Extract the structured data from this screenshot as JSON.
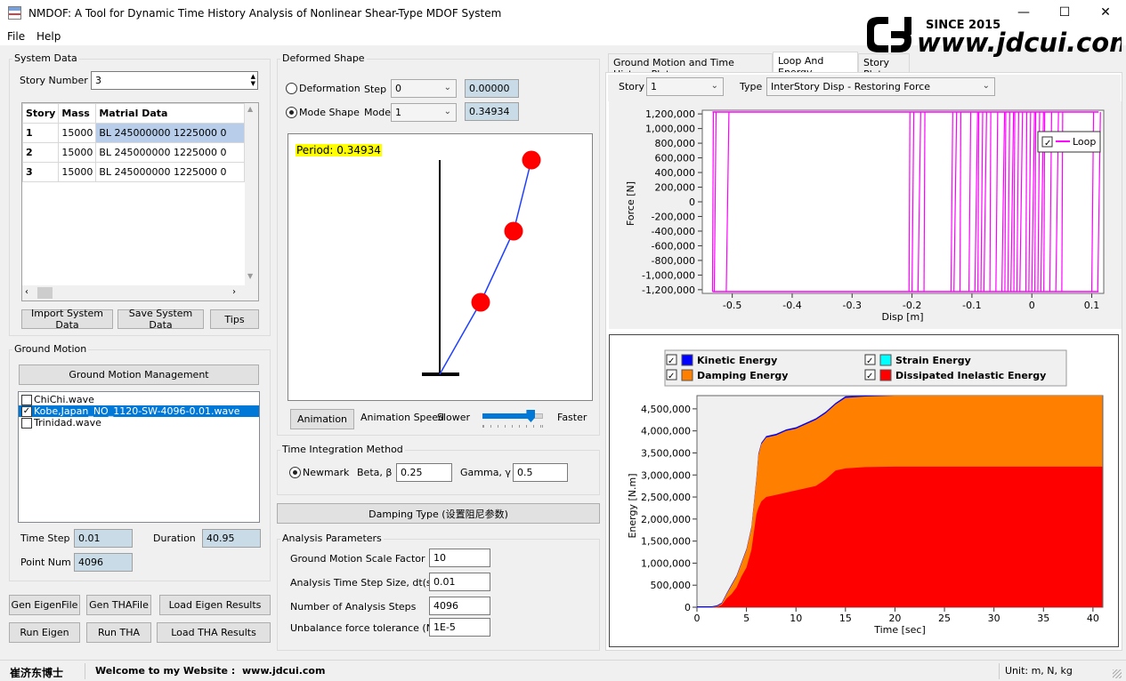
{
  "window": {
    "title": "NMDOF: A Tool for Dynamic Time History Analysis of Nonlinear Shear-Type MDOF System",
    "minimize": "—",
    "maximize": "☐",
    "close": "✕"
  },
  "menu": {
    "file": "File",
    "help": "Help"
  },
  "logo": {
    "since": "SINCE 2015",
    "text": "www.jdcui.com"
  },
  "system_data": {
    "group_label": "System Data",
    "story_number_label": "Story Number",
    "story_number_value": "3",
    "columns": [
      "Story",
      "Mass",
      "Matrial Data"
    ],
    "rows": [
      {
        "story": "1",
        "mass": "15000",
        "material": "BL 245000000 1225000 0"
      },
      {
        "story": "2",
        "mass": "15000",
        "material": "BL 245000000 1225000 0"
      },
      {
        "story": "3",
        "mass": "15000",
        "material": "BL 245000000 1225000 0"
      }
    ],
    "import_button": "Import System Data",
    "save_button": "Save System Data",
    "tips_button": "Tips"
  },
  "ground_motion": {
    "group_label": "Ground Motion",
    "manage_button": "Ground Motion Management",
    "files": [
      {
        "name": "ChiChi.wave",
        "checked": false
      },
      {
        "name": "Kobe,Japan_NO_1120-SW-4096-0.01.wave",
        "checked": true
      },
      {
        "name": "Trinidad.wave",
        "checked": false
      }
    ],
    "time_step_label": "Time Step",
    "time_step_value": "0.01",
    "duration_label": "Duration",
    "duration_value": "40.95",
    "point_num_label": "Point Num",
    "point_num_value": "4096"
  },
  "bottom_buttons": {
    "gen_eigen": "Gen EigenFile",
    "gen_tha": "Gen THAFile",
    "load_eigen": "Load Eigen Results",
    "run_eigen": "Run Eigen",
    "run_tha": "Run THA",
    "load_tha": "Load THA Results"
  },
  "deformed_shape": {
    "group_label": "Deformed Shape",
    "deformation_label": "Deformation",
    "mode_shape_label": "Mode Shape",
    "step_label": "Step",
    "step_value": "0",
    "step_readout": "0.00000",
    "mode_label": "Mode",
    "mode_value": "1",
    "mode_readout": "0.34934",
    "period_text": "Period: 0.34934",
    "animation_button": "Animation",
    "animation_speed_label": "Animation Speed",
    "slower_label": "Slower",
    "faster_label": "Faster",
    "speed_level": 0.8
  },
  "time_integration": {
    "group_label": "Time Integration Method",
    "newmark_label": "Newmark",
    "beta_label": "Beta, β",
    "beta_value": "0.25",
    "gamma_label": "Gamma, γ",
    "gamma_value": "0.5"
  },
  "damping_button": "Damping Type (设置阻尼参数)",
  "analysis_params": {
    "group_label": "Analysis Parameters",
    "scale_label": "Ground Motion Scale Factor",
    "scale_value": "10",
    "dt_label": "Analysis Time Step Size, dt(s)",
    "dt_value": "0.01",
    "steps_label": "Number of Analysis Steps",
    "steps_value": "4096",
    "tol_label": "Unbalance force tolerance (N)",
    "tol_value": "1E-5"
  },
  "tabs": [
    "Ground Motion and Time History Plot",
    "Loop And Energy",
    "Story Plot"
  ],
  "loop_panel": {
    "story_label": "Story",
    "story_value": "1",
    "type_label": "Type",
    "type_value": "InterStory Disp - Restoring Force"
  },
  "chart_data": [
    {
      "type": "line",
      "xlabel": "Disp [m]",
      "ylabel": "Force [N]",
      "xlim": [
        -0.55,
        0.12
      ],
      "ylim": [
        -1250000,
        1250000
      ],
      "xticks": [
        "-0.5",
        "-0.4",
        "-0.3",
        "-0.2",
        "-0.1",
        "0",
        "0.1"
      ],
      "yticks": [
        "1,200,000",
        "1,000,000",
        "800,000",
        "600,000",
        "400,000",
        "200,000",
        "0",
        "-200,000",
        "-400,000",
        "-600,000",
        "-800,000",
        "-1,000,000",
        "-1,200,000"
      ],
      "series": [
        {
          "name": "Loop",
          "color": "#ff00ff"
        }
      ],
      "legend": "top-right",
      "loop_branches": [
        -0.533,
        -0.53,
        -0.51,
        -0.205,
        -0.2,
        -0.19,
        -0.18,
        -0.135,
        -0.13,
        -0.12,
        -0.105,
        -0.095,
        -0.09,
        -0.085,
        -0.08,
        -0.07,
        -0.06,
        -0.05,
        -0.045,
        -0.04,
        -0.035,
        -0.03,
        -0.025,
        -0.02,
        -0.01,
        -0.005,
        0.0,
        0.005,
        0.01,
        0.015,
        0.02,
        0.03,
        0.04,
        0.05,
        0.1,
        0.11
      ],
      "force_cap": 1225000
    },
    {
      "type": "area",
      "xlabel": "Time [sec]",
      "ylabel": "Energy [N.m]",
      "xlim": [
        0,
        41
      ],
      "ylim": [
        0,
        4800000
      ],
      "xticks": [
        "0",
        "5",
        "10",
        "15",
        "20",
        "25",
        "30",
        "35",
        "40"
      ],
      "yticks": [
        "4,500,000",
        "4,000,000",
        "3,500,000",
        "3,000,000",
        "2,500,000",
        "2,000,000",
        "1,500,000",
        "1,000,000",
        "500,000",
        "0"
      ],
      "legend": "top",
      "series": [
        {
          "name": "Kinetic Energy",
          "color": "#0000ff",
          "checked": true
        },
        {
          "name": "Strain Energy",
          "color": "#00ffff",
          "checked": true
        },
        {
          "name": "Damping Energy",
          "color": "#ff8000",
          "checked": true
        },
        {
          "name": "Dissipated Inelastic Energy",
          "color": "#ff0000",
          "checked": true
        }
      ],
      "x": [
        0,
        1.5,
        2,
        2.5,
        3,
        3.5,
        4,
        4.5,
        5,
        5.5,
        6,
        6.2,
        6.5,
        7,
        8,
        9,
        10,
        11,
        12,
        13,
        14,
        15,
        17,
        20,
        25,
        30,
        35,
        40.95
      ],
      "total_energy": [
        0,
        0,
        20000,
        80000,
        300000,
        500000,
        700000,
        1000000,
        1300000,
        1800000,
        2900000,
        3450000,
        3700000,
        3850000,
        3900000,
        4000000,
        4050000,
        4150000,
        4250000,
        4400000,
        4600000,
        4750000,
        4780000,
        4800000,
        4800000,
        4800000,
        4800000,
        4800000
      ],
      "inelastic_energy": [
        0,
        0,
        10000,
        50000,
        200000,
        300000,
        450000,
        700000,
        900000,
        1300000,
        2100000,
        2250000,
        2400000,
        2500000,
        2550000,
        2600000,
        2650000,
        2700000,
        2750000,
        2900000,
        3100000,
        3150000,
        3180000,
        3190000,
        3190000,
        3190000,
        3190000,
        3190000
      ]
    }
  ],
  "status": {
    "author": "崔济东博士",
    "welcome": "Welcome to my Website :",
    "site": "www.jdcui.com",
    "units": "Unit: m, N, kg"
  }
}
